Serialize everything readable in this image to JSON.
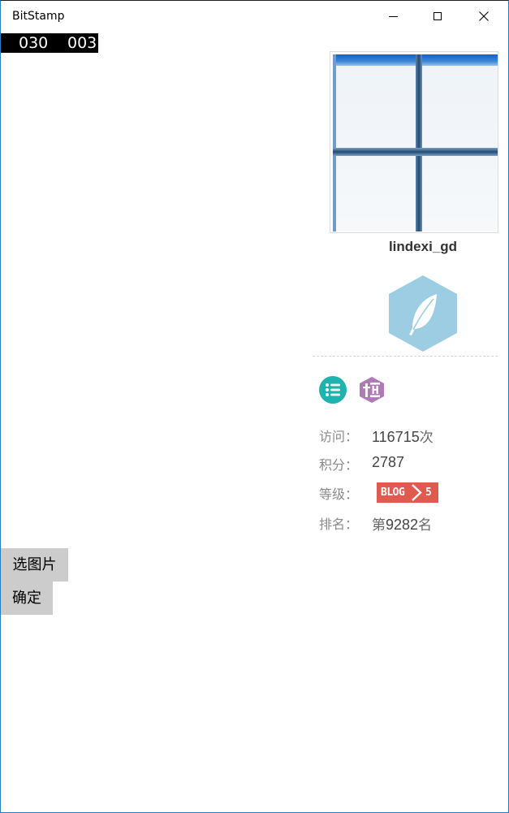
{
  "window": {
    "title": "BitStamp",
    "controls": {
      "minimize": "minimize-icon",
      "maximize": "maximize-icon",
      "close": "close-icon"
    }
  },
  "counter": {
    "first": "030",
    "second": "003"
  },
  "profile": {
    "username": "lindexi_gd",
    "badge_icon": "feather-icon",
    "badge_color": "#9ccde3",
    "icons": [
      {
        "name": "list-icon",
        "color": "#1fb3b0"
      },
      {
        "name": "heng-icon",
        "color": "#b07ab8"
      }
    ],
    "stats": {
      "visits_label": "访问：",
      "visits_value": "116715",
      "visits_unit": "次",
      "score_label": "积分：",
      "score_value": "2787",
      "level_label": "等级：",
      "level_badge_text": "BLOG",
      "level_badge_level": "5",
      "level_badge_color": "#e05a4e",
      "rank_label": "排名：",
      "rank_prefix": "第",
      "rank_value": "9282",
      "rank_unit": "名"
    }
  },
  "actions": {
    "pick_image": "选图片",
    "confirm": "确定"
  }
}
